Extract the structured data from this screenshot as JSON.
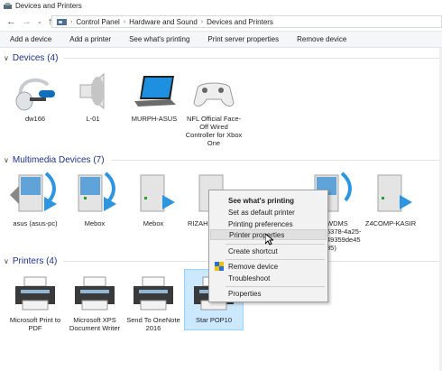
{
  "window": {
    "title": "Devices and Printers"
  },
  "address": {
    "crumbs": [
      "Control Panel",
      "Hardware and Sound",
      "Devices and Printers"
    ]
  },
  "toolbar": {
    "add_device": "Add a device",
    "add_printer": "Add a printer",
    "see_printing": "See what's printing",
    "print_server": "Print server properties",
    "remove_device": "Remove device"
  },
  "groups": {
    "devices": {
      "label": "Devices (4)"
    },
    "multimedia": {
      "label": "Multimedia Devices (7)"
    },
    "printers": {
      "label": "Printers (4)"
    }
  },
  "devices": [
    {
      "name": "dw166",
      "icon": "headset-icon"
    },
    {
      "name": "L-01",
      "icon": "speaker-icon"
    },
    {
      "name": "MURPH-ASUS",
      "icon": "laptop-icon"
    },
    {
      "name": "NFL Official Face-Off Wired Controller for Xbox One",
      "icon": "gamepad-icon"
    }
  ],
  "multimedia": [
    {
      "name": "asus (asus-pc)",
      "icon": "media-server-icon"
    },
    {
      "name": "Mebox",
      "icon": "media-server-icon"
    },
    {
      "name": "Mebox",
      "icon": "media-device-icon"
    },
    {
      "name": "RIZAHI",
      "icon": "media-device-icon"
    },
    {
      "name": "",
      "icon": "media-device-icon"
    },
    {
      "name": "WDMS 5378-4a25- 49359de45 35)",
      "icon": "media-server-icon"
    },
    {
      "name": "Z4COMP-KASIR",
      "icon": "media-device-icon"
    }
  ],
  "printers": [
    {
      "name": "Microsoft Print to PDF",
      "icon": "printer-icon"
    },
    {
      "name": "Microsoft XPS Document Writer",
      "icon": "printer-icon"
    },
    {
      "name": "Send To OneNote 2016",
      "icon": "printer-icon"
    },
    {
      "name": "Star POP10",
      "icon": "printer-icon",
      "selected": true
    }
  ],
  "context_menu": {
    "see_printing": "See what's printing",
    "set_default": "Set as default printer",
    "printing_prefs": "Printing preferences",
    "printer_props": "Printer properties",
    "create_shortcut": "Create shortcut",
    "remove_device": "Remove device",
    "troubleshoot": "Troubleshoot",
    "properties": "Properties"
  },
  "colors": {
    "group_header": "#1e3287",
    "selection": "#cce8ff",
    "menu_hover": "#e0e0e0"
  }
}
